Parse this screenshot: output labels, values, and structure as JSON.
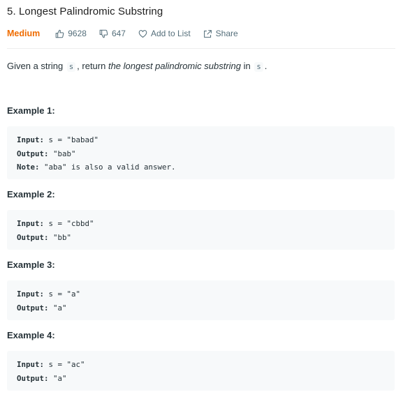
{
  "problem": {
    "title": "5. Longest Palindromic Substring",
    "difficulty": "Medium",
    "likes": "9628",
    "dislikes": "647",
    "add_to_list": "Add to List",
    "share": "Share",
    "colors": {
      "difficulty": "#ef6c00",
      "meta": "#546e7a"
    }
  },
  "description": {
    "pre": "Given a string ",
    "code1": "s",
    "mid": ", return ",
    "emph": "the longest palindromic substring",
    "post": " in ",
    "code2": "s",
    "end": "."
  },
  "examples": [
    {
      "title": "Example 1:",
      "lines": [
        {
          "key": "Input:",
          "value": " s = \"babad\""
        },
        {
          "key": "Output:",
          "value": " \"bab\""
        },
        {
          "key": "Note:",
          "value": " \"aba\" is also a valid answer."
        }
      ]
    },
    {
      "title": "Example 2:",
      "lines": [
        {
          "key": "Input:",
          "value": " s = \"cbbd\""
        },
        {
          "key": "Output:",
          "value": " \"bb\""
        }
      ]
    },
    {
      "title": "Example 3:",
      "lines": [
        {
          "key": "Input:",
          "value": " s = \"a\""
        },
        {
          "key": "Output:",
          "value": " \"a\""
        }
      ]
    },
    {
      "title": "Example 4:",
      "lines": [
        {
          "key": "Input:",
          "value": " s = \"ac\""
        },
        {
          "key": "Output:",
          "value": " \"a\""
        }
      ]
    }
  ]
}
